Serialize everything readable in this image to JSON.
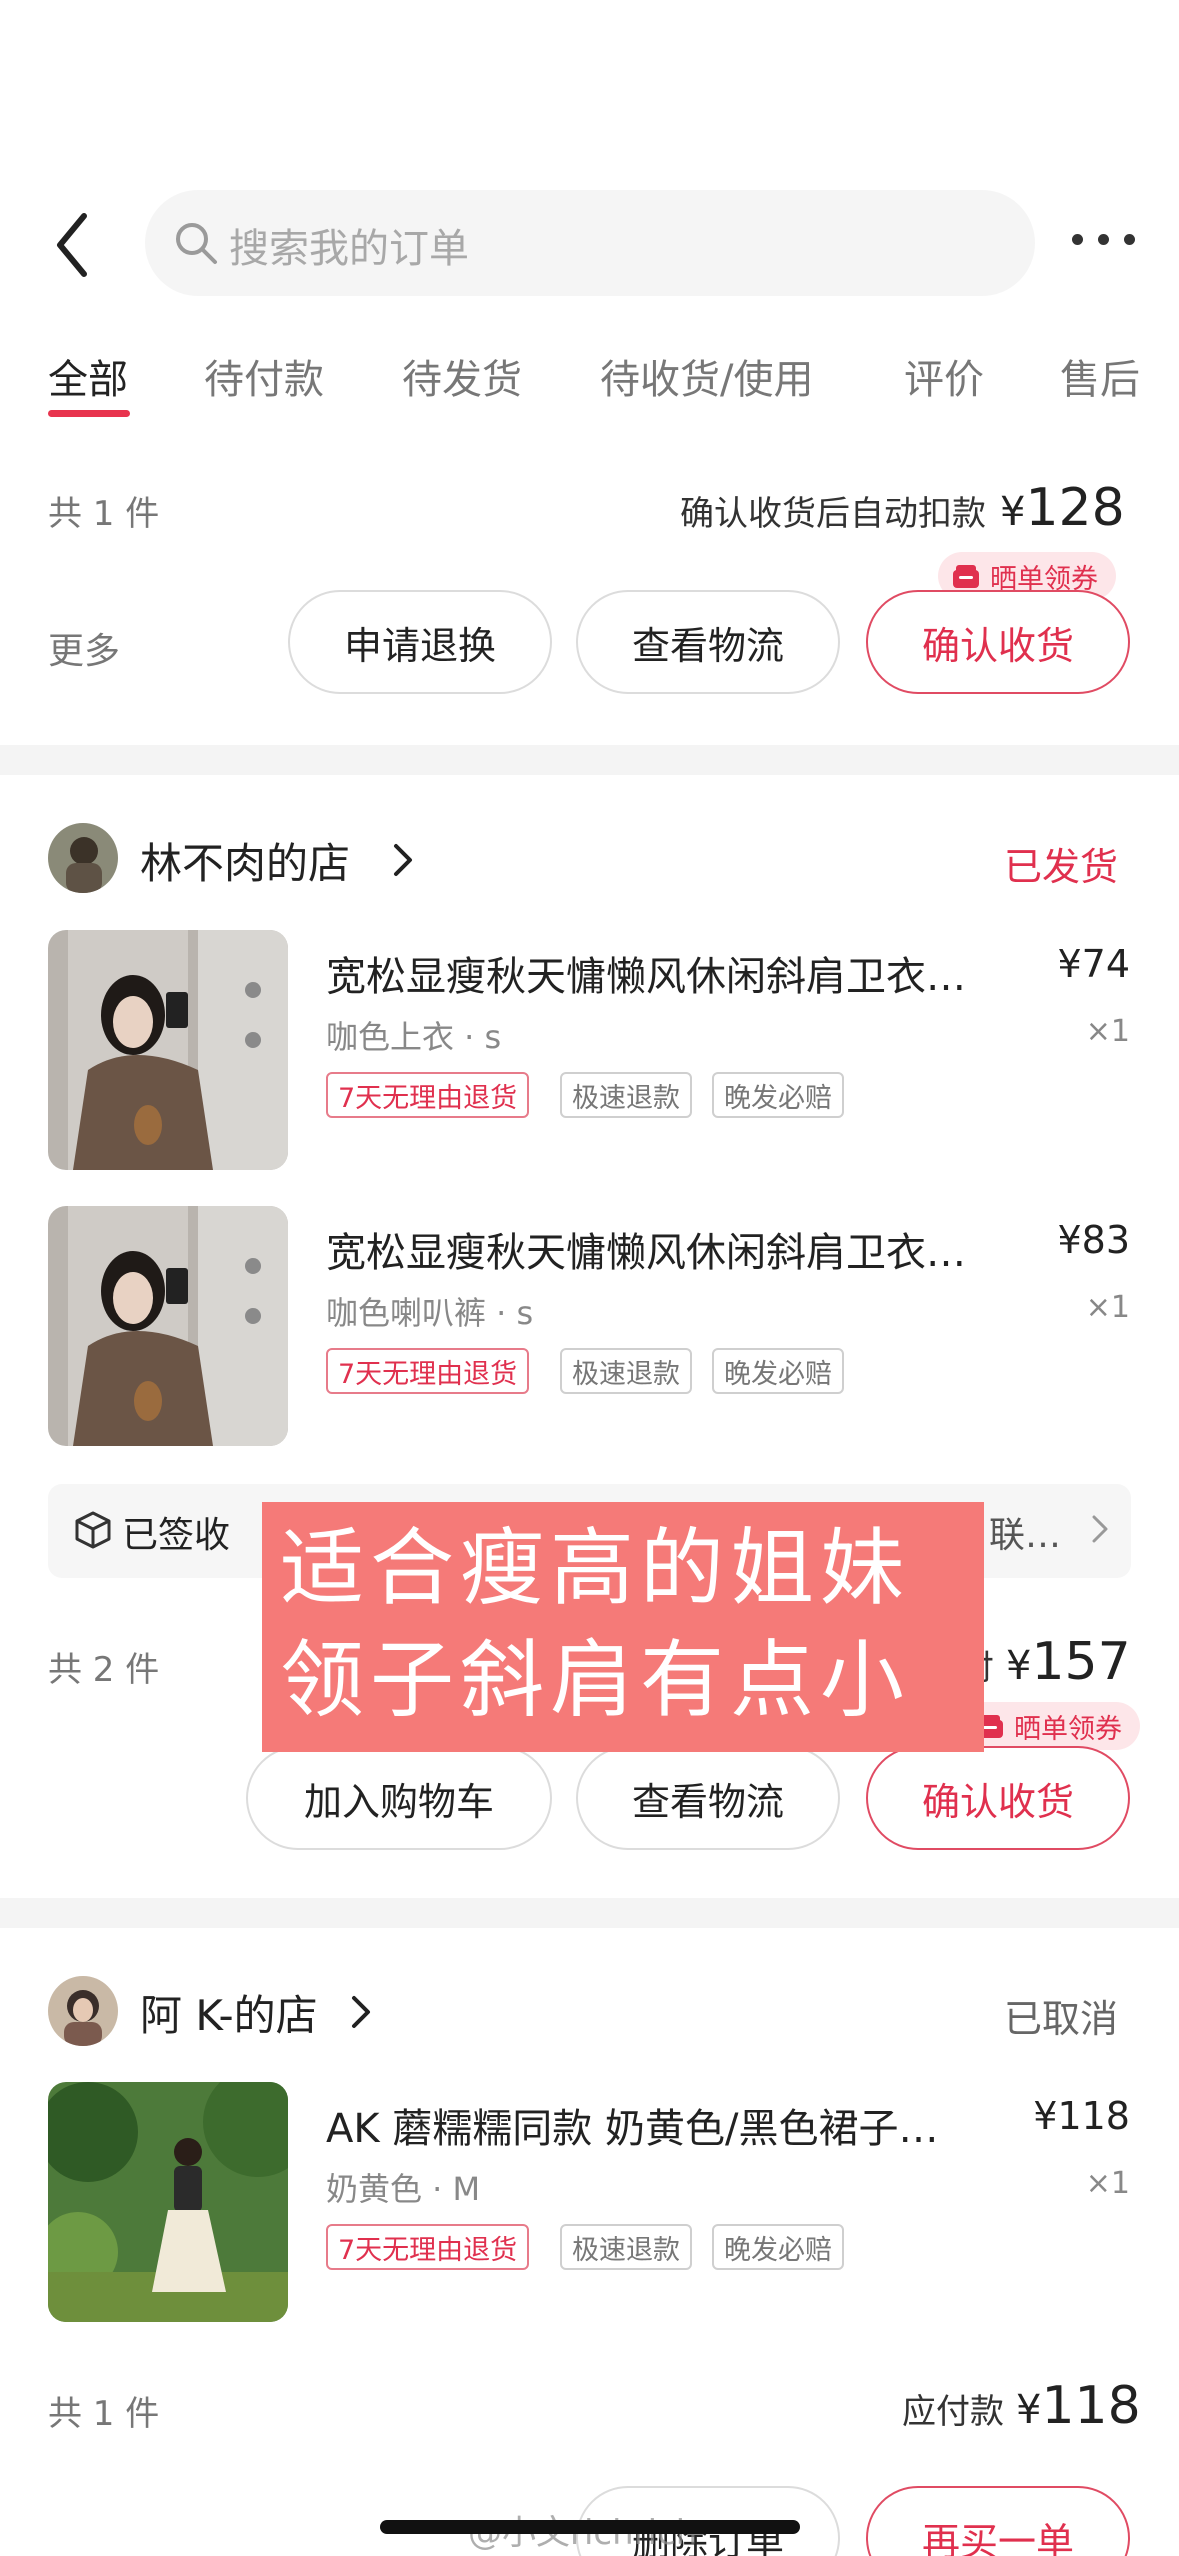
{
  "header": {
    "search_placeholder": "搜索我的订单"
  },
  "tabs": [
    {
      "label": "全部",
      "active": true
    },
    {
      "label": "待付款"
    },
    {
      "label": "待发货"
    },
    {
      "label": "待收货/使用"
    },
    {
      "label": "评价"
    },
    {
      "label": "售后"
    }
  ],
  "order0": {
    "count": "共 1 件",
    "sum_label": "确认收货后自动扣款",
    "currency": "¥",
    "total": "128",
    "coupon": "晒单领券",
    "more": "更多",
    "btn1": "申请退换",
    "btn2": "查看物流",
    "btn3": "确认收货"
  },
  "order1": {
    "shop": "林不肉的店",
    "status": "已发货",
    "items": [
      {
        "title": "宽松显瘦秋天慵懒风休闲斜肩卫衣…",
        "sku": "咖色上衣 · s",
        "price": "¥74",
        "qty": "×1"
      },
      {
        "title": "宽松显瘦秋天慵懒风休闲斜肩卫衣…",
        "sku": "咖色喇叭裤 · s",
        "price": "¥83",
        "qty": "×1"
      }
    ],
    "tags": [
      "7天无理由退货",
      "极速退款",
      "晚发必赔"
    ],
    "logistics_status": "已签收",
    "logistics_tail": "联…",
    "count": "共 2 件",
    "sum_tail": "付",
    "currency": "¥",
    "total": "157",
    "coupon": "晒单领券",
    "btn1": "加入购物车",
    "btn2": "查看物流",
    "btn3": "确认收货"
  },
  "overlay": {
    "line1": "适合瘦高的姐妹",
    "line2": "领子斜肩有点小"
  },
  "order2": {
    "shop": "阿 K-的店",
    "status": "已取消",
    "item": {
      "title": "AK 蘑糯糯同款 奶黄色/黑色裙子…",
      "sku": "奶黄色 · M",
      "price": "¥118",
      "qty": "×1"
    },
    "tags": [
      "7天无理由退货",
      "极速退款",
      "晚发必赔"
    ],
    "count": "共 1 件",
    "sum_label": "应付款",
    "currency": "¥",
    "total": "118",
    "btn2": "删除订单",
    "btn3": "再买一单"
  },
  "watermark": "@小文richrich",
  "colors": {
    "accent": "#e0304e",
    "coupon_bg": "#fde6e9",
    "overlay_bg": "#f57a78"
  }
}
